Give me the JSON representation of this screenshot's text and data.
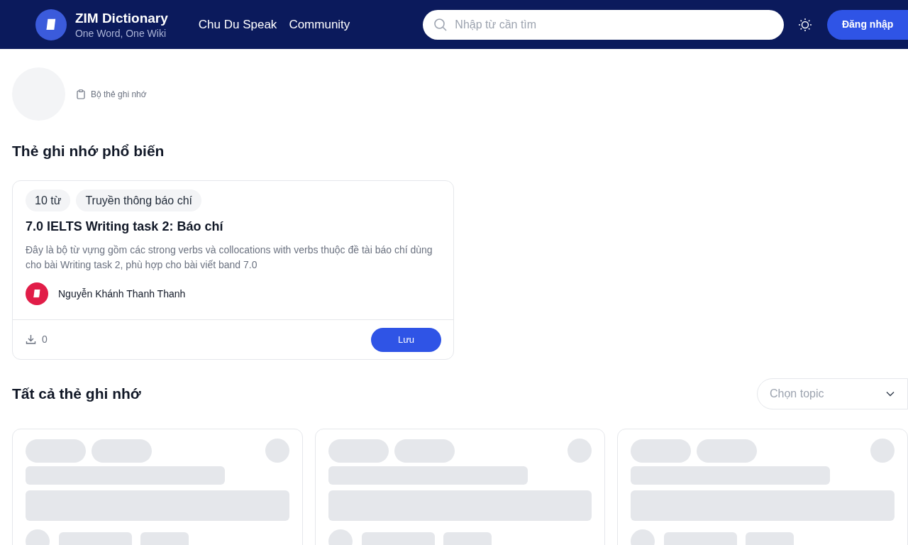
{
  "header": {
    "brand": "ZIM Dictionary",
    "tagline": "One Word, One Wiki",
    "nav": [
      {
        "label": "Chu Du Speak"
      },
      {
        "label": "Community"
      }
    ],
    "search": {
      "placeholder": "Nhập từ cần tìm"
    },
    "login_button": "Đăng nhập"
  },
  "profile": {
    "label": "Bộ thẻ ghi nhớ"
  },
  "popular": {
    "title": "Thẻ ghi nhớ phổ biến",
    "cards": [
      {
        "tags": [
          "10 từ",
          "Truyền thông báo chí"
        ],
        "title": "7.0 IELTS Writing task 2: Báo chí",
        "description": "Đây là bộ từ vựng gồm các strong verbs và collocations with verbs thuộc đề tài báo chí dùng cho bài Writing task 2, phù hợp cho bài viết band 7.0",
        "author": "Nguyễn Khánh Thanh Thanh",
        "downloads": "0",
        "save_button": "Lưu"
      }
    ]
  },
  "all": {
    "title": "Tất cả thẻ ghi nhớ",
    "topic_select": {
      "placeholder": "Chọn topic"
    },
    "cards": [
      {
        "kind": "skeleton"
      },
      {
        "kind": "skeleton"
      },
      {
        "kind": "skeleton"
      }
    ]
  }
}
